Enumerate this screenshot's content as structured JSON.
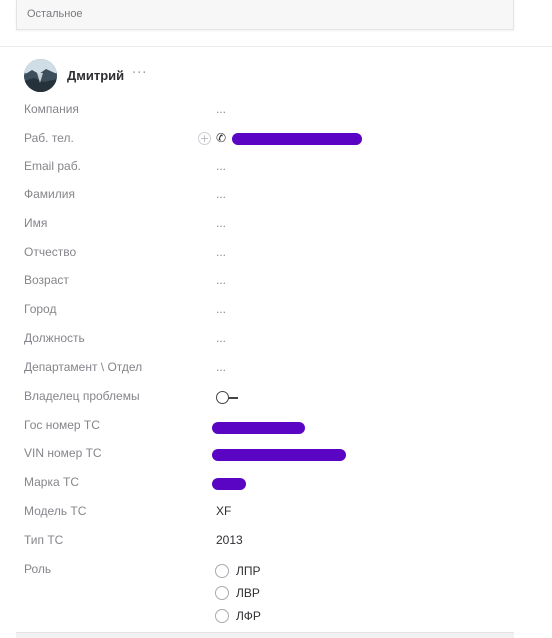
{
  "top_tab": {
    "label": "Остальное"
  },
  "contact": {
    "name": "Дмитрий",
    "more": "···"
  },
  "fields": [
    {
      "label": "Компания",
      "value": "..."
    },
    {
      "label": "Раб. тел.",
      "value": ""
    },
    {
      "label": "Email раб.",
      "value": "..."
    },
    {
      "label": "Фамилия",
      "value": "..."
    },
    {
      "label": "Имя",
      "value": "..."
    },
    {
      "label": "Отчество",
      "value": "..."
    },
    {
      "label": "Возраст",
      "value": "..."
    },
    {
      "label": "Город",
      "value": "..."
    },
    {
      "label": "Должность",
      "value": "..."
    },
    {
      "label": "Департамент \\ Отдел",
      "value": "..."
    },
    {
      "label": "Владелец проблемы",
      "value": ""
    },
    {
      "label": "Гос номер ТС",
      "value": ""
    },
    {
      "label": "VIN номер ТС",
      "value": ""
    },
    {
      "label": "Марка ТС",
      "value": ""
    },
    {
      "label": "Модель ТС",
      "value": "XF"
    },
    {
      "label": "Тип ТС",
      "value": "2013"
    },
    {
      "label": "Роль",
      "value": ""
    }
  ],
  "role_options": [
    "ЛПР",
    "ЛВР",
    "ЛФР"
  ],
  "icons": {
    "add_phone": "plus-circle-icon",
    "phone": "phone-icon",
    "toggle": "toggle-icon"
  },
  "colors": {
    "redaction": "#5b05c4"
  }
}
